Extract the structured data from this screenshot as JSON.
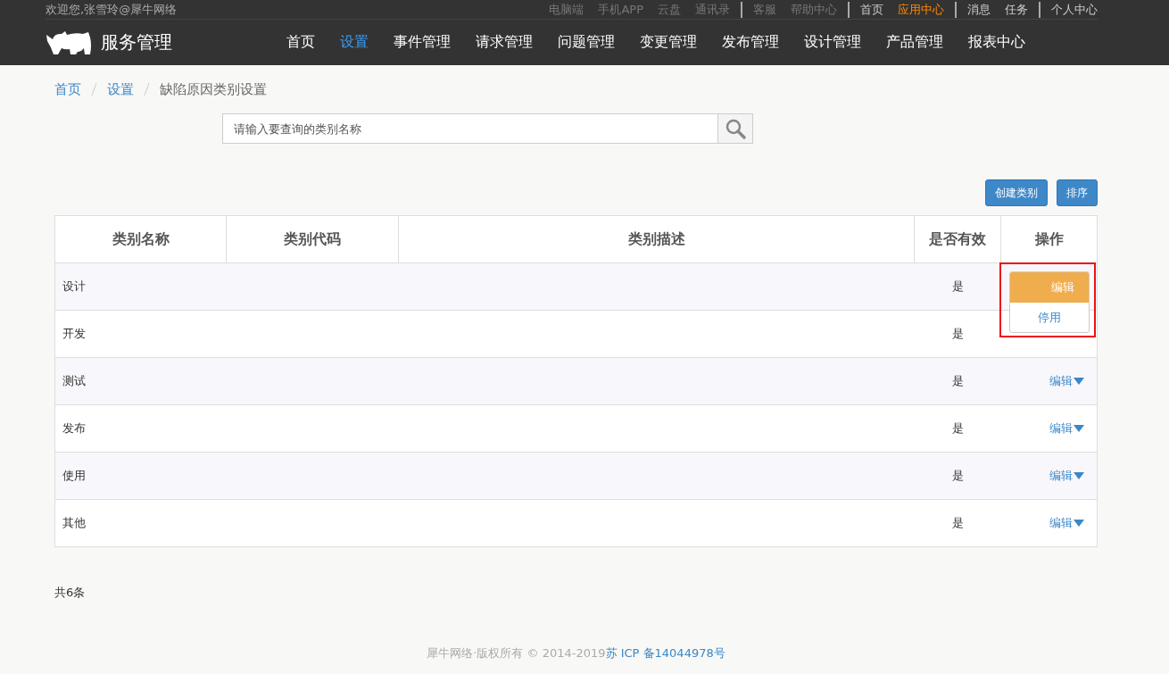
{
  "top_bar": {
    "welcome": "欢迎您,张雪玲@犀牛网络",
    "link_groups": [
      {
        "dim": true,
        "links": [
          {
            "label": "电脑端",
            "active": false
          },
          {
            "label": "手机APP",
            "active": false
          },
          {
            "label": "云盘",
            "active": false
          },
          {
            "label": "通讯录",
            "active": false
          }
        ]
      },
      {
        "dim": true,
        "links": [
          {
            "label": "客服",
            "active": false
          },
          {
            "label": "帮助中心",
            "active": false
          }
        ]
      },
      {
        "dim": false,
        "links": [
          {
            "label": "首页",
            "active": false
          },
          {
            "label": "应用中心",
            "active": true
          }
        ]
      },
      {
        "dim": false,
        "links": [
          {
            "label": "消息",
            "active": false
          },
          {
            "label": "任务",
            "active": false
          }
        ]
      },
      {
        "dim": false,
        "links": [
          {
            "label": "个人中心",
            "active": false
          }
        ]
      }
    ]
  },
  "brand": "服务管理",
  "nav": [
    {
      "label": "首页",
      "selected": false
    },
    {
      "label": "设置",
      "selected": true
    },
    {
      "label": "事件管理",
      "selected": false
    },
    {
      "label": "请求管理",
      "selected": false
    },
    {
      "label": "问题管理",
      "selected": false
    },
    {
      "label": "变更管理",
      "selected": false
    },
    {
      "label": "发布管理",
      "selected": false
    },
    {
      "label": "设计管理",
      "selected": false
    },
    {
      "label": "产品管理",
      "selected": false
    },
    {
      "label": "报表中心",
      "selected": false
    }
  ],
  "breadcrumb": [
    {
      "label": "首页",
      "link": true
    },
    {
      "label": "设置",
      "link": true
    },
    {
      "label": "缺陷原因类别设置",
      "link": false
    }
  ],
  "search": {
    "placeholder": "请输入要查询的类别名称"
  },
  "buttons": [
    "创建类别",
    "排序"
  ],
  "table": {
    "columns": [
      "类别名称",
      "类别代码",
      "类别描述",
      "是否有效",
      "操作"
    ],
    "rows": [
      {
        "name": "设计",
        "valid": "是",
        "menu": [
          "编辑",
          "停用"
        ]
      },
      {
        "name": "开发",
        "valid": "是"
      },
      {
        "name": "测试",
        "valid": "是",
        "action": "编辑"
      },
      {
        "name": "发布",
        "valid": "是",
        "action": "编辑"
      },
      {
        "name": "使用",
        "valid": "是",
        "action": "编辑"
      },
      {
        "name": "其他",
        "valid": "是",
        "action": "编辑"
      }
    ]
  },
  "total": "共6条",
  "footer": {
    "copyright": "犀牛网络·版权所有 © 2014-2019",
    "icp": "苏 ICP 备14044978号"
  }
}
